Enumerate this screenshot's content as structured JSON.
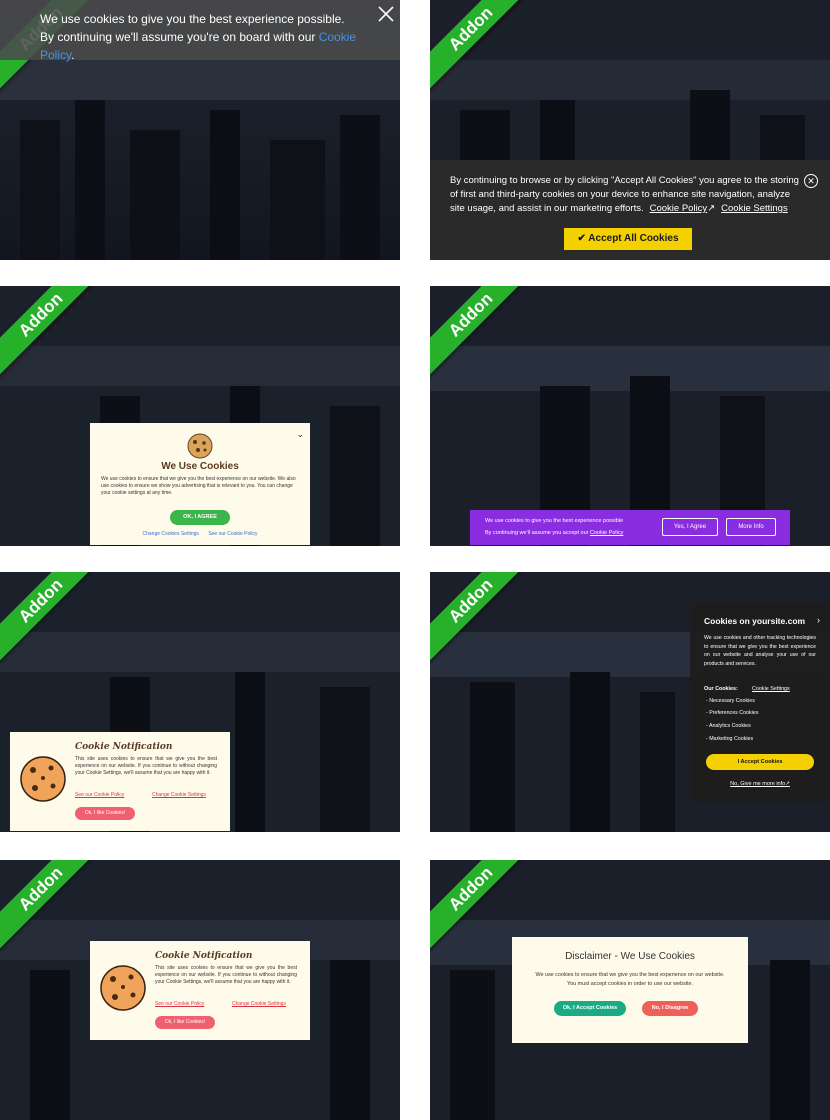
{
  "ribbon_label": "Addon",
  "colors": {
    "ribbon": "#27b12a",
    "link_blue": "#4a90e2",
    "accent_yellow": "#f5d000",
    "purple": "#8a2ce0",
    "green_button": "#3cb64b",
    "pink_button": "#f06070",
    "teal_button": "#1aab85",
    "disagree_button": "#f0605a"
  },
  "tile1": {
    "text": "We use cookies to give you the best experience possible. By continuing we'll assume you're on board with our",
    "link": "Cookie Policy",
    "period": ".",
    "close_icon": "close-icon"
  },
  "tile2": {
    "text": "By continuing to browse or by clicking \"Accept All Cookies\" you agree to the storing of first and third-party cookies on your device to enhance site navigation, analyze site usage, and assist in our marketing efforts.",
    "policy_link": "Cookie Policy",
    "settings_link": "Cookie Settings",
    "button": "Accept All Cookies"
  },
  "tile3": {
    "title": "We Use Cookies",
    "description": "We use cookies to ensure that we give you the best experience on our website. We also use cookies to ensure we show you advertising that is relevant to you. You can change your cookie settings at any time.",
    "button": "OK, I AGREE",
    "link_settings": "Change Cookies Settings",
    "link_policy": "See our Cookie Policy"
  },
  "tile4": {
    "line1": "We use cookies to give you the best experience possible",
    "line2": "By continuing we'll assume you accept our",
    "link": "Cookie Policy",
    "agree_button": "Yes, I Agree",
    "more_button": "More Info"
  },
  "tile5": {
    "title": "Cookie Notification",
    "description": "This site uses cookies to ensure that we give you the best experience on our website. If you continue to without changing your Cookie Settings, we'll assume that you are happy with it.",
    "link_policy": "See our Cookie Policy",
    "link_settings": "Change Cookie Settings",
    "button": "Ok, I like Cookies!"
  },
  "tile6": {
    "heading": "Cookies on yoursite.com",
    "description": "We use cookies and other tracking technologies to ensure that we give you the best experience on our website and analyse your use of our products and services.",
    "our_cookies_label": "Our Cookies:",
    "settings_link": "Cookie Settings",
    "items": [
      "- Necessary Cookies",
      "- Preferences Cookies",
      "- Analytics Cookies",
      "- Marketing Cookies"
    ],
    "button": "I Accept Cookies",
    "decline_link": "No, Give me more info"
  },
  "tile7": {
    "title": "Cookie Notification",
    "description": "This site uses cookies to ensure that we give you the best experience on our website. If you continue to without changing your Cookie Settings, we'll assume that you are happy with it.",
    "link_policy": "See our Cookie Policy",
    "link_settings": "Change Cookie Settings",
    "button": "Ok, I like Cookies!"
  },
  "tile8": {
    "title": "Disclaimer - We Use Cookies",
    "description": "We use cookies to ensure that we give you the best experience on our website. You must accept cookies in order to use our website.",
    "accept_button": "Ok, I Accept Cookies",
    "disagree_button": "No, I Disagree"
  }
}
